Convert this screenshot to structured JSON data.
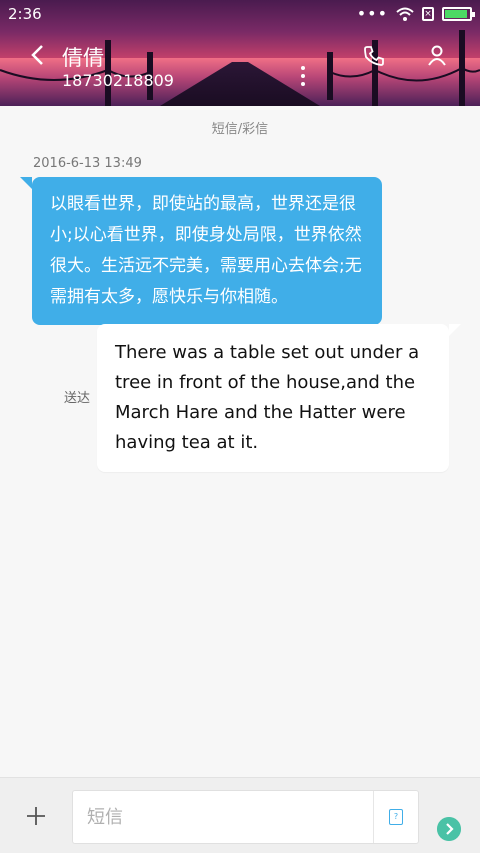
{
  "statusbar": {
    "time": "2:36"
  },
  "header": {
    "contact_name": "倩倩",
    "contact_number": "18730218809"
  },
  "conversation": {
    "message_type": "短信/彩信",
    "timestamp": "2016-6-13 13:49",
    "messages": [
      {
        "direction": "incoming",
        "text": "以眼看世界，即使站的最高，世界还是很小;以心看世界，即使身处局限，世界依然很大。生活远不完美，需要用心去体会;无需拥有太多，愿快乐与你相随。"
      },
      {
        "direction": "outgoing",
        "text": "There was a table set out under a tree in front of the house,and the March Hare and the Hatter were having tea at it.",
        "status": "送达"
      }
    ]
  },
  "composer": {
    "placeholder": "短信"
  },
  "colors": {
    "accent": "#40aee8",
    "send": "#4ac2a6"
  },
  "icons": [
    "back-icon",
    "phone-icon",
    "more-icon",
    "person-icon",
    "plus-icon",
    "sim-icon",
    "send-icon",
    "wifi-icon",
    "battery-icon"
  ]
}
